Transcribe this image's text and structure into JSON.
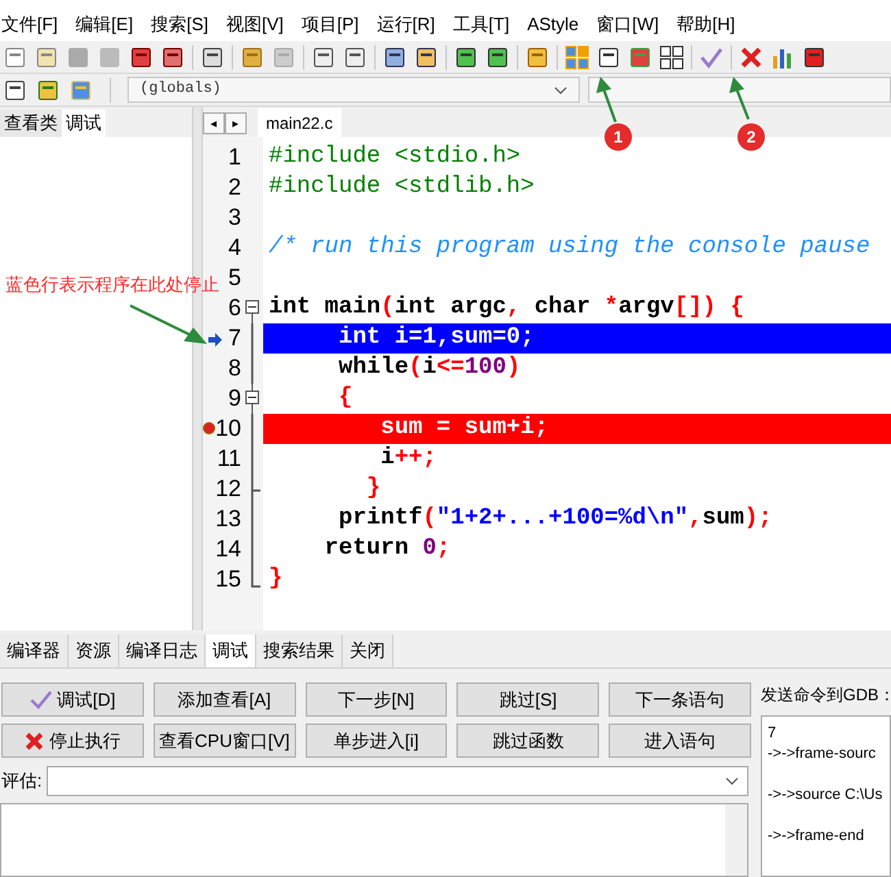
{
  "menu": [
    "文件[F]",
    "编辑[E]",
    "搜索[S]",
    "视图[V]",
    "项目[P]",
    "运行[R]",
    "工具[T]",
    "AStyle",
    "窗口[W]",
    "帮助[H]"
  ],
  "scope_combo": {
    "value": "(globals)"
  },
  "left_tabs": [
    {
      "label": "查看类",
      "selected": false
    },
    {
      "label": "调试",
      "selected": true
    }
  ],
  "editor_nav": [
    "◂",
    "▸"
  ],
  "editor_tabs": [
    {
      "label": "main22.c",
      "selected": true
    }
  ],
  "code": [
    {
      "number": "1",
      "fold_box": false,
      "in_block": false,
      "block_end": false,
      "current": false,
      "breakpoint": false,
      "tokens": [
        {
          "kind": "pp",
          "text": "#include <stdio.h>"
        }
      ]
    },
    {
      "number": "2",
      "fold_box": false,
      "in_block": false,
      "block_end": false,
      "current": false,
      "breakpoint": false,
      "tokens": [
        {
          "kind": "pp",
          "text": "#include <stdlib.h>"
        }
      ]
    },
    {
      "number": "3",
      "fold_box": false,
      "in_block": false,
      "block_end": false
    },
    {
      "number": "4",
      "fold_box": false,
      "in_block": false,
      "block_end": false,
      "current": false,
      "breakpoint": false,
      "tokens": [
        {
          "kind": "cm",
          "text": "/* run this program using the console pause"
        }
      ]
    },
    {
      "number": "5",
      "fold_box": false,
      "in_block": false,
      "block_end": false
    },
    {
      "number": "6",
      "fold_box": true,
      "in_block": false,
      "block_end": false,
      "current": false,
      "breakpoint": false,
      "tokens": [
        {
          "kind": "kw",
          "text": "int main"
        },
        {
          "kind": "sym",
          "text": "("
        },
        {
          "kind": "kw",
          "text": "int argc"
        },
        {
          "kind": "sym",
          "text": ","
        },
        {
          "kind": "kw",
          "text": " char "
        },
        {
          "kind": "sym",
          "text": "*"
        },
        {
          "kind": "kw",
          "text": "argv"
        },
        {
          "kind": "sym",
          "text": "[]) {"
        }
      ]
    },
    {
      "number": "7",
      "fold_box": false,
      "in_block": true,
      "block_end": false,
      "current": true,
      "breakpoint": false,
      "tokens": [
        {
          "kind": "kw",
          "text": "     int i=1,sum=0;"
        }
      ]
    },
    {
      "number": "8",
      "fold_box": false,
      "in_block": true,
      "block_end": false,
      "current": false,
      "breakpoint": false,
      "tokens": [
        {
          "kind": "kw",
          "text": "     while"
        },
        {
          "kind": "sym",
          "text": "("
        },
        {
          "kind": "kw",
          "text": "i"
        },
        {
          "kind": "sym",
          "text": "<="
        },
        {
          "kind": "num",
          "text": "100"
        },
        {
          "kind": "sym",
          "text": ")"
        }
      ]
    },
    {
      "number": "9",
      "fold_box": true,
      "in_block": true,
      "block_end": false,
      "current": false,
      "breakpoint": false,
      "tokens": [
        {
          "kind": "sym",
          "text": "     {"
        }
      ]
    },
    {
      "number": "10",
      "fold_box": false,
      "in_block": true,
      "block_end": false,
      "current": false,
      "breakpoint": true,
      "tokens": [
        {
          "kind": "kw",
          "text": "        sum = sum+i;"
        }
      ]
    },
    {
      "number": "11",
      "fold_box": false,
      "in_block": true,
      "block_end": false,
      "current": false,
      "breakpoint": false,
      "tokens": [
        {
          "kind": "kw",
          "text": "        i"
        },
        {
          "kind": "sym",
          "text": "++;"
        }
      ]
    },
    {
      "number": "12",
      "fold_box": false,
      "in_block": true,
      "block_end": true,
      "current": false,
      "breakpoint": false,
      "tokens": [
        {
          "kind": "sym",
          "text": "       }"
        }
      ]
    },
    {
      "number": "13",
      "fold_box": false,
      "in_block": true,
      "block_end": false,
      "current": false,
      "breakpoint": false,
      "tokens": [
        {
          "kind": "kw",
          "text": "     printf"
        },
        {
          "kind": "sym",
          "text": "("
        },
        {
          "kind": "str",
          "text": "\"1+2+...+100=%d\\n\""
        },
        {
          "kind": "sym",
          "text": ","
        },
        {
          "kind": "kw",
          "text": "sum"
        },
        {
          "kind": "sym",
          "text": ");"
        }
      ]
    },
    {
      "number": "14",
      "fold_box": false,
      "in_block": true,
      "block_end": false,
      "current": false,
      "breakpoint": false,
      "tokens": [
        {
          "kind": "kw",
          "text": "    return "
        },
        {
          "kind": "num",
          "text": "0"
        },
        {
          "kind": "sym",
          "text": ";"
        }
      ]
    },
    {
      "number": "15",
      "fold_box": false,
      "in_block": true,
      "block_end": true,
      "current": false,
      "breakpoint": false,
      "tokens": [
        {
          "kind": "sym",
          "text": "}"
        }
      ]
    }
  ],
  "annotation": {
    "text": "蓝色行表示程序在此处停止"
  },
  "markers": [
    "1",
    "2"
  ],
  "bottom_tabs": [
    {
      "label": "编译器",
      "selected": false
    },
    {
      "label": "资源",
      "selected": false
    },
    {
      "label": "编译日志",
      "selected": false
    },
    {
      "label": "调试",
      "selected": true
    },
    {
      "label": "搜索结果",
      "selected": false
    },
    {
      "label": "关闭",
      "selected": false
    }
  ],
  "debug_buttons": [
    "调试[D]",
    "添加查看[A]",
    "下一步[N]",
    "跳过[S]",
    "下一条语句",
    "停止执行",
    "查看CPU窗口[V]",
    "单步进入[i]",
    "跳过函数",
    "进入语句"
  ],
  "evaluate": {
    "label": "评估:"
  },
  "gdb": {
    "label": "发送命令到GDB：",
    "lines": [
      "7",
      "->->frame-sourc",
      "->->source C:\\Us",
      "->->frame-end"
    ]
  }
}
